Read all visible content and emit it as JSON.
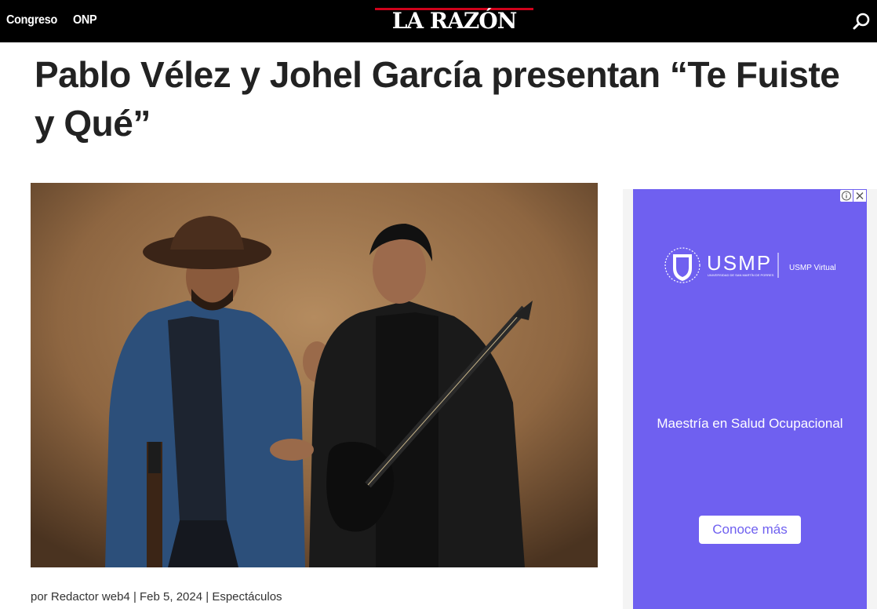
{
  "header": {
    "nav": [
      "Congreso",
      "ONP"
    ],
    "logo_text": "LA RAZÓN"
  },
  "article": {
    "title": "Pablo Vélez y Johel García presentan “Te Fuiste y Qué”",
    "byline_prefix": "por",
    "author": "Redactor web4",
    "sep1": "|",
    "date": "Feb 5, 2024",
    "sep2": "|",
    "category": "Espectáculos"
  },
  "ad": {
    "brand": "USMP",
    "brand_sub": "UNIVERSIDAD DE SAN MARTÍN DE PORRES",
    "brand_virtual": "USMP Virtual",
    "message": "Maestría en Salud Ocupacional",
    "cta": "Conoce más"
  },
  "colors": {
    "topbar": "#000000",
    "logo_accent": "#d0021b",
    "ad_background": "#6f60f0",
    "title": "#222222"
  }
}
